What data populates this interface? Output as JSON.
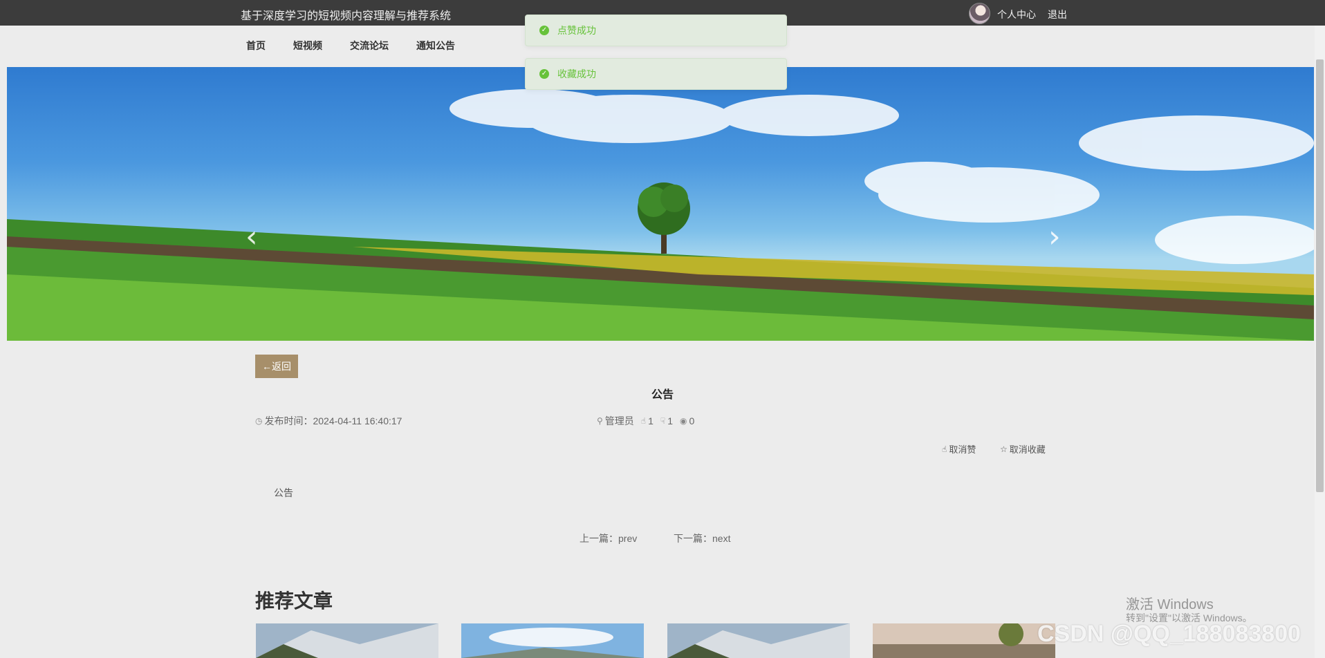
{
  "header": {
    "site_title": "基于深度学习的短视频内容理解与推荐系统",
    "user_center": "个人中心",
    "logout": "退出"
  },
  "nav": [
    "首页",
    "短视频",
    "交流论坛",
    "通知公告"
  ],
  "toasts": [
    "点赞成功",
    "收藏成功"
  ],
  "banner": {
    "prev_arrow": "‹",
    "next_arrow": "›",
    "slide_count": 3,
    "active_slide": 1
  },
  "article": {
    "back_label": "←返回",
    "title": "公告",
    "publish_label": "发布时间：2024-04-11 16:40:17",
    "author": "管理员",
    "likes": "1",
    "dislikes": "1",
    "views": "0",
    "unlike_label": "取消赞",
    "unfavorite_label": "取消收藏",
    "content": "公告",
    "prev_label": "上一篇：prev",
    "next_label": "下一篇：next"
  },
  "recommend": {
    "title": "推荐文章"
  },
  "overlay": {
    "activate_title": "激活 Windows",
    "activate_hint": "转到\"设置\"以激活 Windows。",
    "csdn": "CSDN @QQ_188083800"
  },
  "icons": {
    "success": "check-circle-icon",
    "clock": "clock-icon",
    "user": "user-icon",
    "thumb_up": "thumb-up-icon",
    "thumb_down": "thumb-down-icon",
    "eye": "eye-icon",
    "star": "star-icon"
  },
  "colors": {
    "topbar": "#3c3c3c",
    "accent": "#a78f6a",
    "success": "#67c23a"
  }
}
